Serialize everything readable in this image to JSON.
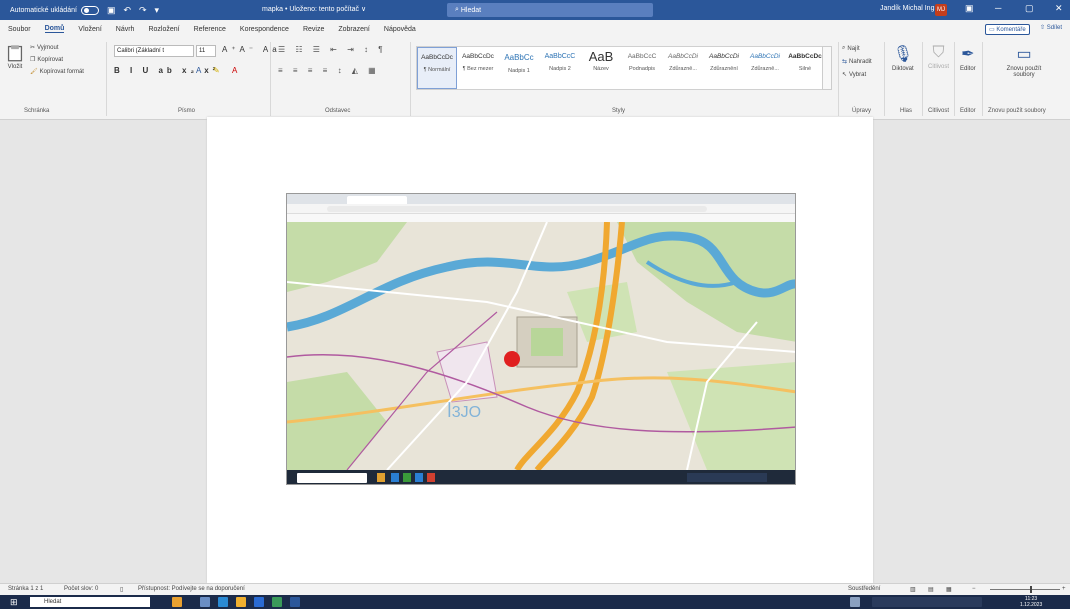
{
  "titlebar": {
    "autosave_label": "Automatické ukládání",
    "doc_title": "mapka • Uloženo: tento počítač ∨",
    "search_placeholder": "Hledat",
    "user_name": "Jandík Michal Ing.",
    "avatar_initials": "MJ"
  },
  "menu": {
    "tabs": [
      "Soubor",
      "Domů",
      "Vložení",
      "Návrh",
      "Rozložení",
      "Reference",
      "Korespondence",
      "Revize",
      "Zobrazení",
      "Nápověda"
    ],
    "active_tab": "Domů",
    "comments_label": "Komentáře",
    "share_label": "Sdílet"
  },
  "ribbon": {
    "clipboard": {
      "paste_label": "Vložit",
      "cut_label": "Vyjmout",
      "copy_label": "Kopírovat",
      "format_painter_label": "Kopírovat formát",
      "group_label": "Schránka"
    },
    "font": {
      "font_name": "Calibri (Základní t",
      "font_size": "11",
      "group_label": "Písmo"
    },
    "paragraph": {
      "group_label": "Odstavec"
    },
    "styles": {
      "items": [
        {
          "sample": "AaBbCcDc",
          "name": "¶ Normální"
        },
        {
          "sample": "AaBbCcDc",
          "name": "¶ Bez mezer"
        },
        {
          "sample": "AaBbCc",
          "name": "Nadpis 1"
        },
        {
          "sample": "AaBbCcC",
          "name": "Nadpis 2"
        },
        {
          "sample": "AaB",
          "name": "Název"
        },
        {
          "sample": "AaBbCcC",
          "name": "Podnadpis"
        },
        {
          "sample": "AaBbCcDi",
          "name": "Zdůrazně..."
        },
        {
          "sample": "AaBbCcDi",
          "name": "Zdůraznění"
        },
        {
          "sample": "AaBbCcDi",
          "name": "Zdůrazně..."
        },
        {
          "sample": "AaBbCcDc",
          "name": "Silné"
        }
      ],
      "group_label": "Styly"
    },
    "editing": {
      "find_label": "Najít",
      "replace_label": "Nahradit",
      "select_label": "Vybrat",
      "group_label": "Úpravy"
    },
    "voice": {
      "dictate_label": "Diktovat",
      "group_label": "Hlas"
    },
    "sensitivity": {
      "label": "Citlivost",
      "group_label": "Citlivost"
    },
    "editor": {
      "label": "Editor",
      "group_label": "Editor"
    },
    "reuse": {
      "label": "Znovu použít soubory",
      "group_label": "Znovu použít soubory"
    }
  },
  "statusbar": {
    "page_info": "Stránka 1 z 1",
    "word_count": "Počet slov: 0",
    "accessibility": "Přístupnost: Podívejte se na doporučení",
    "focus_label": "Soustředění",
    "zoom": "100 %"
  },
  "taskbar": {
    "search_placeholder": "Hledat",
    "time": "11:23",
    "date": "1.12.2023"
  },
  "colors": {
    "word_blue": "#2b579a",
    "marker_red": "#e02020",
    "map_water": "#5aa9d6",
    "map_green": "#b9d89a",
    "map_road": "#f0a830"
  }
}
